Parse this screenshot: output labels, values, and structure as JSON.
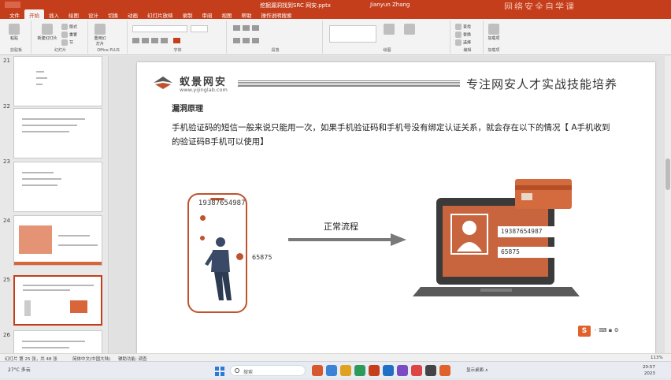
{
  "window": {
    "title": "挖掘漏洞找到SRC 网安.pptx",
    "user": "Jianyun Zhang",
    "watermark": "网络安全自学课"
  },
  "ribbon_tabs": [
    "文件",
    "开始",
    "插入",
    "绘图",
    "设计",
    "切换",
    "动画",
    "幻灯片放映",
    "录制",
    "审阅",
    "视图",
    "帮助",
    "操作说明搜索"
  ],
  "ribbon": {
    "paste": "粘贴",
    "new_slide": "新建幻灯片",
    "layout": "版式",
    "reset": "重置",
    "section": "节",
    "reuse": "重用幻灯片",
    "speech": "听写",
    "find": "查找",
    "replace": "替换",
    "select": "选择",
    "addins": "加载项",
    "groups": [
      "剪贴板",
      "幻灯片",
      "Office PLUS",
      "字体",
      "段落",
      "绘图",
      "编辑",
      "加载项"
    ]
  },
  "thumbnails": [
    {
      "num": "21"
    },
    {
      "num": "22"
    },
    {
      "num": "23"
    },
    {
      "num": "24"
    },
    {
      "num": "25"
    },
    {
      "num": "26"
    }
  ],
  "slide": {
    "brand": "蚁景网安",
    "url": "www.yijinglab.com",
    "slogan": "专注网安人才实战技能培养",
    "section_title": "漏洞原理",
    "paragraph": "手机验证码的短信一般来说只能用一次，如果手机验证码和手机号没有绑定认证关系，就会存在以下的情况【 A手机收到的验证码B手机可以使用】",
    "phone_number": "19387654987",
    "code": "65875",
    "flow_label": "正常流程",
    "monitor_number": "19387654987",
    "monitor_code": "65875",
    "badge": "S"
  },
  "statusbar": {
    "slide_info": "幻灯片 第 25 张，共 48 张",
    "language": "简体中文(中国大陆)",
    "accessibility": "辅助功能: 调查",
    "zoom": "113%"
  },
  "taskbar": {
    "weather": "27°C 多云",
    "search_placeholder": "搜索",
    "tray": "显示桌面 ∧",
    "time": "20:57",
    "date": "2023"
  },
  "colors": {
    "accent": "#c43e1c",
    "illustration": "#c9653e"
  }
}
